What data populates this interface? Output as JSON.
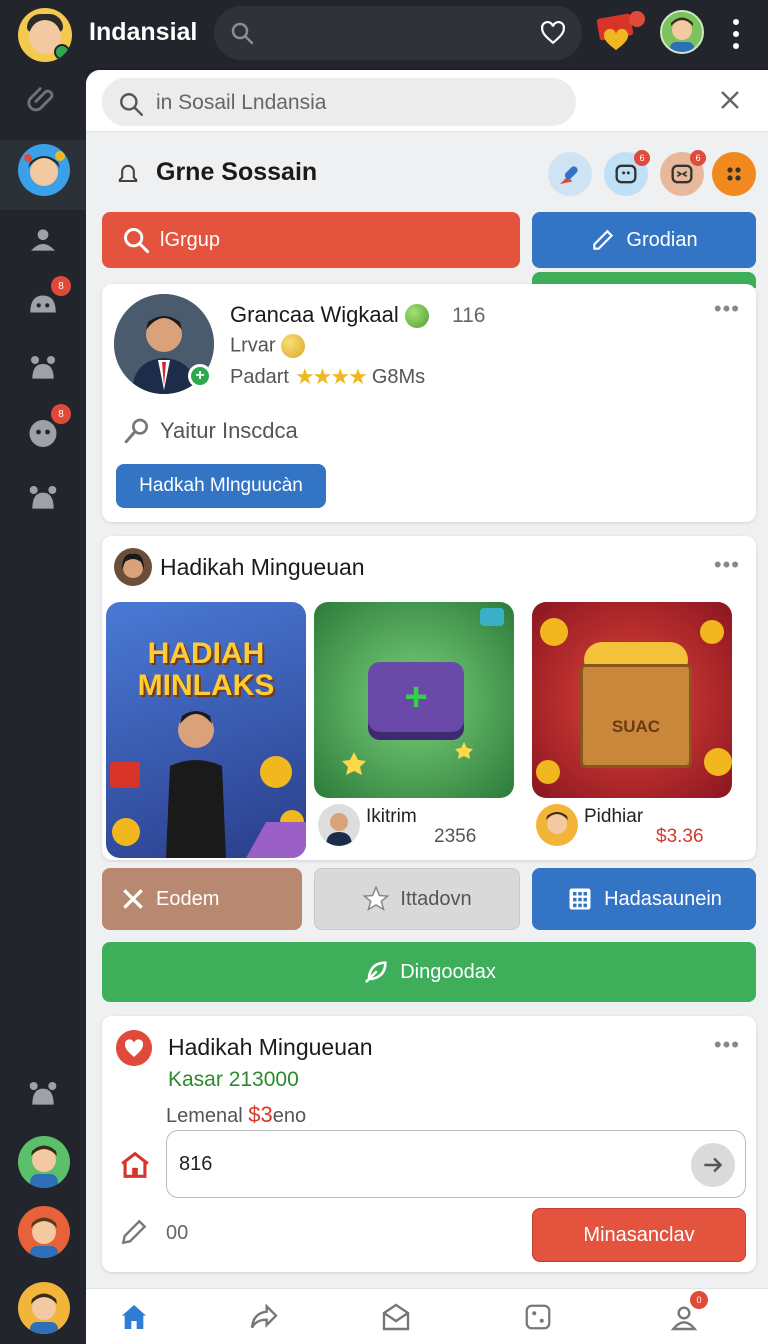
{
  "app": {
    "name": "Indansial"
  },
  "panel": {
    "search_placeholder": "in Sosail Lndansia",
    "section_title": "Grne Sossain"
  },
  "buttons": {
    "search_group": "lGrgup",
    "grodian": "Grodian",
    "eodem": "Eodem",
    "ittadovn": "Ittadovn",
    "hadasaunein": "Hadasaunein",
    "dingoodax": "Dingoodax"
  },
  "profile": {
    "name": "Grancaa Wigkaal",
    "count": "116",
    "subtitle": "Lrvar",
    "rank_label": "Padart",
    "rank_value": "G8Ms",
    "note": "Yaitur Inscdca",
    "button": "Hadkah Mlnguucàn"
  },
  "gifts": {
    "title": "Hadikah Mingueuan",
    "banner_title": "HADIAH MINLAKS",
    "chest_label": "SUAC",
    "tiles": [
      {
        "name": "Ikitrim",
        "value": "2356"
      },
      {
        "name": "Pidhiar",
        "value": "$3.36"
      }
    ]
  },
  "reward": {
    "title": "Hadikah Mingueuan",
    "amount": "Kasar 213000",
    "line_prefix": "Lemenal",
    "line_value": "$3",
    "line_suffix": "eno",
    "input_value": "816",
    "small_value": "00",
    "submit": "Minasanclav"
  },
  "rail_badges": [
    "8",
    "8"
  ],
  "head_badges": [
    "6",
    "6"
  ],
  "nav_badge": "0",
  "colors": {
    "accent_red": "#e3533d",
    "accent_blue": "#3474c4",
    "accent_green": "#3fae5b",
    "rail_bg": "#22252b"
  }
}
